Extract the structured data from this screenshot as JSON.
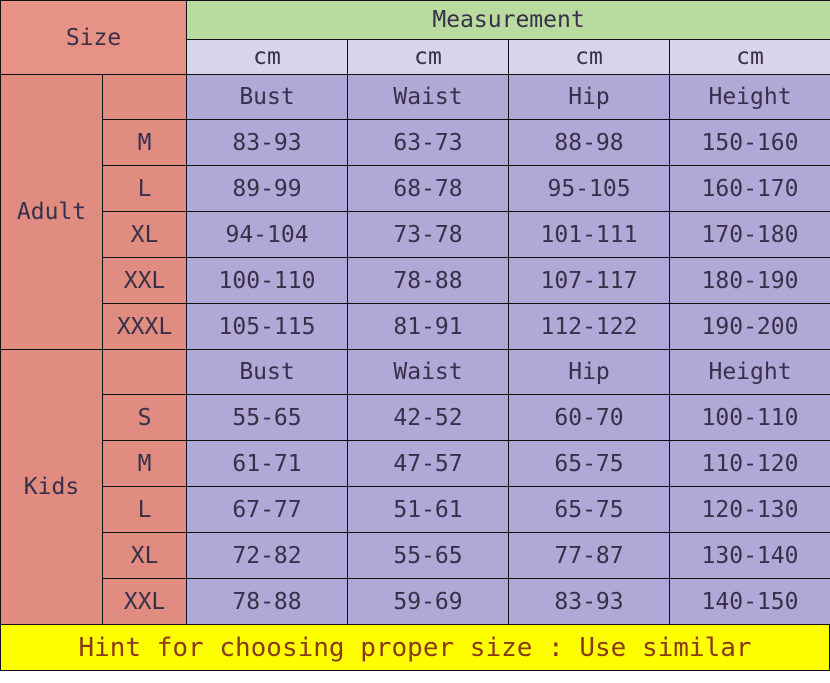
{
  "table": {
    "size_header": "Size",
    "measurement_header": "Measurement",
    "units": [
      "cm",
      "cm",
      "cm",
      "cm"
    ],
    "groups": [
      {
        "name": "Adult",
        "metric_labels": [
          "Bust",
          "Waist",
          "Hip",
          "Height"
        ],
        "rows": [
          {
            "size": "M",
            "values": [
              "83-93",
              "63-73",
              "88-98",
              "150-160"
            ]
          },
          {
            "size": "L",
            "values": [
              "89-99",
              "68-78",
              "95-105",
              "160-170"
            ]
          },
          {
            "size": "XL",
            "values": [
              "94-104",
              "73-78",
              "101-111",
              "170-180"
            ]
          },
          {
            "size": "XXL",
            "values": [
              "100-110",
              "78-88",
              "107-117",
              "180-190"
            ]
          },
          {
            "size": "XXXL",
            "values": [
              "105-115",
              "81-91",
              "112-122",
              "190-200"
            ]
          }
        ]
      },
      {
        "name": "Kids",
        "metric_labels": [
          "Bust",
          "Waist",
          "Hip",
          "Height"
        ],
        "rows": [
          {
            "size": "S",
            "values": [
              "55-65",
              "42-52",
              "60-70",
              "100-110"
            ]
          },
          {
            "size": "M",
            "values": [
              "61-71",
              "47-57",
              "65-75",
              "110-120"
            ]
          },
          {
            "size": "L",
            "values": [
              "67-77",
              "51-61",
              "65-75",
              "120-130"
            ]
          },
          {
            "size": "XL",
            "values": [
              "72-82",
              "55-65",
              "77-87",
              "130-140"
            ]
          },
          {
            "size": "XXL",
            "values": [
              "78-88",
              "59-69",
              "83-93",
              "140-150"
            ]
          }
        ]
      }
    ]
  },
  "hint": "Hint for choosing proper size : Use similar"
}
